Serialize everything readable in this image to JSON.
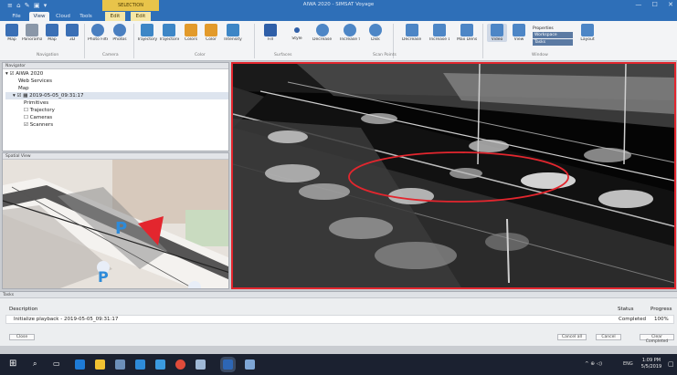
{
  "titlebar": {
    "quick_access": "≡ ⌂ ✎ ▣ ▾",
    "window_title": "AIWA 2020 - SIMSAT Voyage",
    "contextual_tab": "SELECTION",
    "window_controls": "— ☐ ✕"
  },
  "tabs": [
    {
      "label": "File"
    },
    {
      "label": "View"
    },
    {
      "label": "Cloud"
    },
    {
      "label": "Tools"
    },
    {
      "label": "Edit"
    },
    {
      "label": "Edit"
    }
  ],
  "ribbon": {
    "buttons": [
      {
        "label": "Map",
        "icon": "map-icon",
        "color": "#3a6fb5"
      },
      {
        "label": "Panorama",
        "icon": "panorama-icon",
        "color": "#8a97a8"
      },
      {
        "label": "Map",
        "icon": "map-view-icon",
        "color": "#3a6fb5"
      },
      {
        "label": "3D",
        "icon": "cube-3d-icon",
        "color": "#3a6fb5"
      },
      {
        "label": "Photo Filters",
        "icon": "photo-filter-icon",
        "color": "#4a7fc0"
      },
      {
        "label": "Photos",
        "icon": "photos-icon",
        "color": "#4a7fc0"
      },
      {
        "label": "Trajectory",
        "icon": "trajectory-icon",
        "color": "#3d86c6"
      },
      {
        "label": "Trajectories",
        "icon": "trajectories-icon",
        "color": "#3d86c6"
      },
      {
        "label": "Colors",
        "icon": "colors-icon",
        "color": "#e29a2b"
      },
      {
        "label": "Color",
        "icon": "paint-bucket-icon",
        "color": "#e29a2b"
      },
      {
        "label": "Intensity",
        "icon": "intensity-icon",
        "color": "#3d86c6"
      },
      {
        "label": "Fill",
        "icon": "fill-icon",
        "color": "#2f5fa8"
      },
      {
        "label": "Style",
        "icon": "style-icon",
        "color": "#2f5fa8"
      },
      {
        "label": "Decrease Size",
        "icon": "decrease-size-icon",
        "color": "#4d86c6"
      },
      {
        "label": "Increase Size",
        "icon": "increase-size-icon",
        "color": "#4d86c6"
      },
      {
        "label": "Disk",
        "icon": "disk-icon",
        "color": "#4d86c6"
      },
      {
        "label": "Decrease Density",
        "icon": "decrease-density-icon",
        "color": "#4d86c6"
      },
      {
        "label": "Increase Density",
        "icon": "increase-density-icon",
        "color": "#4d86c6"
      },
      {
        "label": "Max Density",
        "icon": "max-density-icon",
        "color": "#4d86c6"
      },
      {
        "label": "Video",
        "icon": "video-icon",
        "color": "#4d86c6"
      },
      {
        "label": "View",
        "icon": "view-icon",
        "color": "#4d86c6"
      },
      {
        "label": "Layout",
        "icon": "layout-icon",
        "color": "#4d86c6"
      }
    ],
    "small_items": [
      "Properties",
      "Workspace",
      "Tasks"
    ],
    "groups": [
      "Navigation",
      "Camera",
      "Color",
      "Surfaces",
      "Scan Points",
      "Window"
    ]
  },
  "navigator": {
    "title": "Navigator",
    "items": [
      {
        "label": "AIWA 2020"
      },
      {
        "label": "Web Services"
      },
      {
        "label": "Map"
      },
      {
        "label": "2019-05-05_09:31:17"
      },
      {
        "label": "Primitives"
      },
      {
        "label": "Trajectory"
      },
      {
        "label": "Cameras"
      },
      {
        "label": "Scanners"
      }
    ]
  },
  "spatial_view": {
    "title": "Spatial View",
    "marker": "P"
  },
  "status_panel": {
    "title": "Tasks",
    "col_description": "Description",
    "col_status": "Status",
    "col_progress": "Progress",
    "row_description": "Initialize playback - 2019-05-05_09:31:17",
    "row_status": "Completed",
    "row_progress": "100%",
    "progress_value": 1,
    "btn_left": "Close",
    "btn_cancel_all": "Cancel all",
    "btn_cancel": "Cancel",
    "btn_clear": "Clear Completed"
  },
  "taskbar": {
    "time": "1:09 PM",
    "date": "5/5/2019",
    "lang": "ENG",
    "tray": "^ ⊕ ◁)"
  }
}
